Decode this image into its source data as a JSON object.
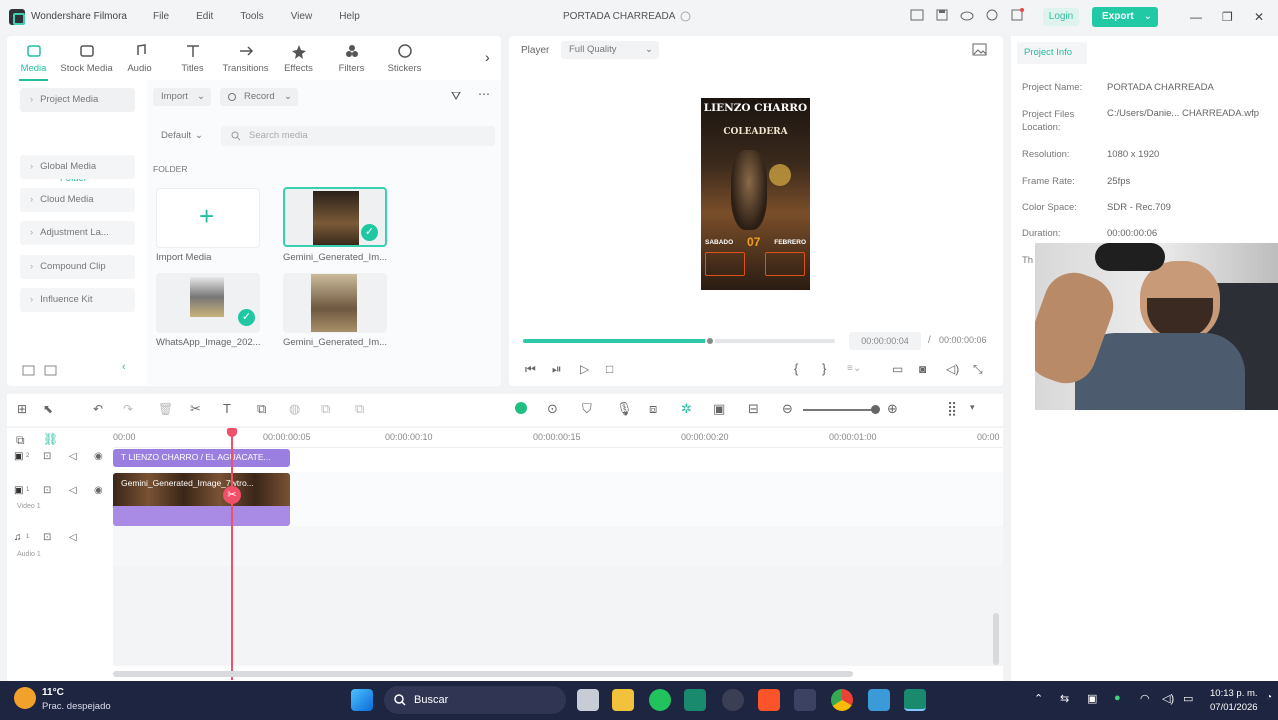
{
  "app": {
    "name": "Wondershare Filmora",
    "menu": [
      "File",
      "Edit",
      "Tools",
      "View",
      "Help"
    ],
    "project_title": "PORTADA CHARREADA",
    "login_label": "Login",
    "export_label": "Export"
  },
  "media_tabs": [
    "Media",
    "Stock Media",
    "Audio",
    "Titles",
    "Transitions",
    "Effects",
    "Filters",
    "Stickers"
  ],
  "sidebar": {
    "items": [
      "Project Media",
      "Global Media",
      "Cloud Media",
      "Adjustment La...",
      "Compound Clip",
      "Influence Kit"
    ],
    "folder_label": "Folder"
  },
  "media_toolbar": {
    "import_label": "Import",
    "record_label": "Record",
    "sort_label": "Default",
    "search_placeholder": "Search media",
    "section_label": "FOLDER"
  },
  "media_items": [
    {
      "label": "Import Media"
    },
    {
      "label": "Gemini_Generated_Im..."
    },
    {
      "label": "WhatsApp_Image_202..."
    },
    {
      "label": "Gemini_Generated_Im..."
    }
  ],
  "player": {
    "label": "Player",
    "quality": "Full Quality",
    "current_time": "00:00:00:04",
    "separator": "/",
    "total_time": "00:00:00:06",
    "progress": 0.6,
    "poster": {
      "title": "LIENZO CHARRO",
      "subtitle": "COLEADERA",
      "date_left": "SABADO",
      "date_num": "07",
      "date_right": "FEBRERO"
    }
  },
  "project_info": {
    "tab_label": "Project Info",
    "rows": [
      {
        "label": "Project Name:",
        "value": "PORTADA CHARREADA"
      },
      {
        "label": "Project Files Location:",
        "value": "C:/Users/Danie... CHARREADA.wfp"
      },
      {
        "label": "Resolution:",
        "value": "1080 x 1920"
      },
      {
        "label": "Frame Rate:",
        "value": "25fps"
      },
      {
        "label": "Color Space:",
        "value": "SDR - Rec.709"
      },
      {
        "label": "Duration:",
        "value": "00:00:00:06"
      }
    ],
    "cut_label": "Th"
  },
  "timeline": {
    "ruler": [
      "00:00",
      "00:00:00:05",
      "00:00:00:10",
      "00:00:00:15",
      "00:00:00:20",
      "00:00:01:00",
      "00:00"
    ],
    "tracks": [
      {
        "num": "2",
        "name": ""
      },
      {
        "num": "1",
        "name": "Video 1"
      },
      {
        "num": "1",
        "name": "Audio 1"
      }
    ],
    "title_clip": "LIENZO CHARRO / EL AGUACATE...",
    "video_clip": "Gemini_Generated_Image_7wtro..."
  },
  "taskbar": {
    "temp": "11°C",
    "weather": "Prac. despejado",
    "search_label": "Buscar",
    "time": "10:13 p. m.",
    "date": "07/01/2026"
  },
  "colors": {
    "accent": "#20bfa0",
    "playhead": "#f0506a",
    "clip_purple": "#9b7fe0"
  }
}
